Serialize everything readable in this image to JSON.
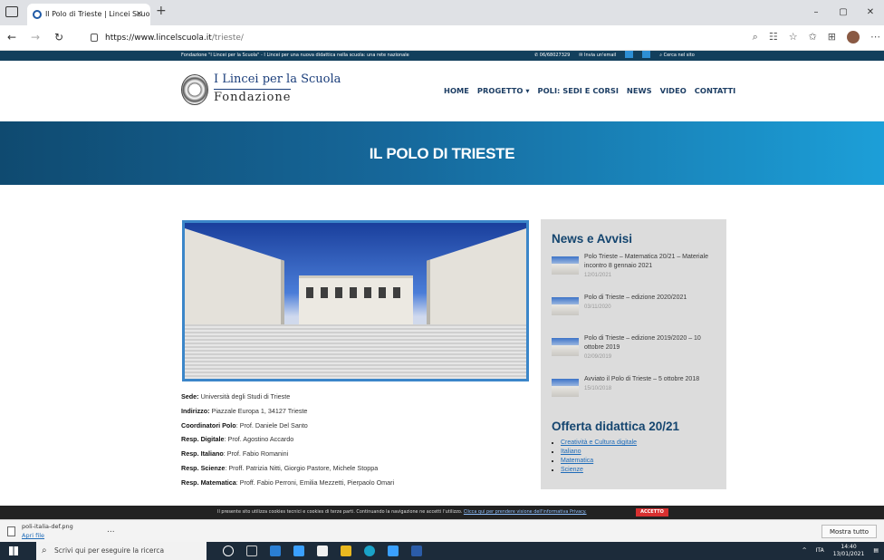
{
  "browser": {
    "tab_title": "Il Polo di Trieste | Lincei Scuola",
    "tab_close": "×",
    "new_tab": "+",
    "url_scheme": "https://www.lincelscuola.it",
    "url_path": "/trieste/",
    "window_buttons": [
      "–",
      "▢",
      "✕"
    ]
  },
  "topstrip": {
    "message": "Fondazione \"I Lincei per la Scuola\" - I Lincei per una nuova didattica nella scuola: una rete nazionale",
    "phone": "✆ 06/68027329",
    "email": "✉ Invia un'email",
    "search": "⌕ Cerca nel sito"
  },
  "logo": {
    "line1": "I Lincei per la Scuola",
    "line2": "Fondazione"
  },
  "nav": [
    "HOME",
    "PROGETTO ▾",
    "POLI: SEDI E CORSI",
    "NEWS",
    "VIDEO",
    "CONTATTI"
  ],
  "hero": {
    "title": "IL POLO DI TRIESTE"
  },
  "info": [
    {
      "label": "Sede:",
      "value": " Università degli Studi di Trieste"
    },
    {
      "label": "Indirizzo:",
      "value": " Piazzale Europa 1, 34127 Trieste"
    },
    {
      "label": "Coordinatori Polo",
      "value": ": Prof. Daniele Del Santo"
    },
    {
      "label": "Resp. Digitale",
      "value": ": Prof. Agostino Accardo"
    },
    {
      "label": "Resp. Italiano",
      "value": ": Prof. Fabio Romanini"
    },
    {
      "label": "Resp. Scienze",
      "value": ": Proff. Patrizia Nitti, Giorgio Pastore, Michele Stoppa"
    },
    {
      "label": "Resp. Matematica",
      "value": ": Proff. Fabio Perroni, Emilia Mezzetti, Pierpaolo Omari"
    }
  ],
  "sidebar": {
    "news_title": "News e Avvisi",
    "news": [
      {
        "title": "Polo Trieste – Matematica 20/21 – Materiale incontro 8 gennaio 2021",
        "date": "12/01/2021"
      },
      {
        "title": "Polo di Trieste – edizione 2020/2021",
        "date": "03/11/2020"
      },
      {
        "title": "Polo di Trieste – edizione 2019/2020 – 10 ottobre 2019",
        "date": "02/09/2019"
      },
      {
        "title": "Avviato il Polo di Trieste – 5 ottobre 2018",
        "date": "15/10/2018"
      }
    ],
    "offer_title": "Offerta didattica 20/21",
    "offer": [
      "Creatività e Cultura digitale",
      "Italiano",
      "Matematica",
      "Scienze"
    ]
  },
  "cookie": {
    "text": "Il presente sito utilizza cookies tecnici e cookies di terze parti. Continuando la navigazione ne accetti l'utilizzo.",
    "link": "Clicca qui per prendere visione dell'informativa Privacy.",
    "accept": "ACCETTO"
  },
  "download": {
    "file": "poli-italia-def.png",
    "open": "Apri file",
    "more": "...",
    "show_all": "Mostra tutto"
  },
  "taskbar": {
    "search_placeholder": "Scrivi qui per eseguire la ricerca",
    "lang": "ITA",
    "time": "14:40",
    "date": "13/01/2021"
  }
}
